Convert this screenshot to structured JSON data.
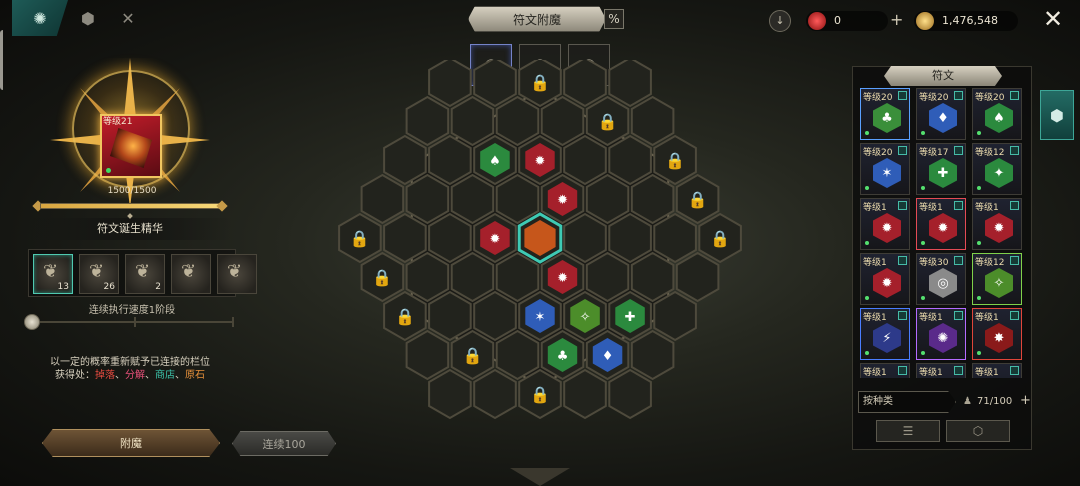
{
  "left_tabs": [
    {
      "icon": "gear-emblem-icon",
      "active": true
    },
    {
      "icon": "hexagon-icon",
      "active": false
    },
    {
      "icon": "crossed-tools-icon",
      "active": false
    }
  ],
  "essence": {
    "level_label": "等级21",
    "count_text": "1500/1500",
    "fill_fraction": 1.0,
    "name": "符文诞生精华"
  },
  "materials": [
    {
      "icon": "rune-fragment-icon",
      "qty": "13",
      "selected": true
    },
    {
      "icon": "rune-fragment-icon",
      "qty": "26",
      "selected": false
    },
    {
      "icon": "rune-fragment-icon",
      "qty": "2",
      "selected": false
    },
    {
      "icon": "rune-fragment-icon",
      "qty": "",
      "selected": false
    },
    {
      "icon": "rune-fragment-icon",
      "qty": "",
      "selected": false
    }
  ],
  "speed": {
    "label": "连续执行速度1阶段",
    "level_fraction": 0
  },
  "description": {
    "line1": "以一定的概率重新赋予已连接的栏位",
    "source_prefix": "获得处：",
    "sources": [
      "掉落",
      "分解",
      "商店",
      "原石"
    ],
    "separator": "、"
  },
  "buttons": {
    "enchant": "附魔",
    "continuous": "连续100"
  },
  "center": {
    "title": "符文附魔",
    "percent_symbol": "%",
    "rune_tabs": [
      {
        "icon": "spiral-rune-icon",
        "active": true
      },
      {
        "icon": "spiral-rune-icon",
        "active": false
      },
      {
        "icon": "spiral-rune-icon",
        "active": false
      }
    ]
  },
  "currency": {
    "download_icon": "download-arrow-icon",
    "red_gem": {
      "icon": "red-gem-icon",
      "value": "0"
    },
    "gold": {
      "icon": "gold-coin-icon",
      "value": "1,476,548"
    },
    "plus_symbol": "+",
    "close_symbol": "✕"
  },
  "rune_panel": {
    "title": "符文",
    "side_tab_icon": "hexagon-emblem-icon",
    "cards": [
      {
        "level": "等级20",
        "color": "#3a8f3a",
        "border": "#5aa0ff",
        "glyph": "♣"
      },
      {
        "level": "等级20",
        "color": "#2f5db8",
        "border": "#3e3c36",
        "glyph": "♦"
      },
      {
        "level": "等级20",
        "color": "#2b8a3e",
        "border": "#3e3c36",
        "glyph": "♠"
      },
      {
        "level": "等级20",
        "color": "#2f5db8",
        "border": "#3e3c36",
        "glyph": "✶"
      },
      {
        "level": "等级17",
        "color": "#2b8a3e",
        "border": "#3e3c36",
        "glyph": "✚"
      },
      {
        "level": "等级12",
        "color": "#2b8a3e",
        "border": "#3e3c36",
        "glyph": "✦"
      },
      {
        "level": "等级1",
        "color": "#a5202b",
        "border": "#3e3c36",
        "glyph": "✹"
      },
      {
        "level": "等级1",
        "color": "#a5202b",
        "border": "#e44b55",
        "glyph": "✹"
      },
      {
        "level": "等级1",
        "color": "#a5202b",
        "border": "#3e3c36",
        "glyph": "✹"
      },
      {
        "level": "等级1",
        "color": "#a5202b",
        "border": "#3e3c36",
        "glyph": "✹"
      },
      {
        "level": "等级30",
        "color": "#8a8a8a",
        "border": "#3e3c36",
        "glyph": "◎"
      },
      {
        "level": "等级12",
        "color": "#4c8d2a",
        "border": "#7fd14a",
        "glyph": "✧"
      },
      {
        "level": "等级1",
        "color": "#2d3a8a",
        "border": "#4a7dff",
        "glyph": "⚡"
      },
      {
        "level": "等级1",
        "color": "#5a2a8a",
        "border": "#b46bff",
        "glyph": "✺"
      },
      {
        "level": "等级1",
        "color": "#8a1a1a",
        "border": "#e0453a",
        "glyph": "✸"
      },
      {
        "level": "等级1",
        "color": "#2b7a3a",
        "border": "#3e3c36",
        "glyph": "✶"
      },
      {
        "level": "等级1",
        "color": "#2b7a3a",
        "border": "#3e3c36",
        "glyph": "✶"
      },
      {
        "level": "等级1",
        "color": "#2b7a3a",
        "border": "#3e3c36",
        "glyph": "✶"
      }
    ],
    "sort_label": "按种类",
    "capacity": "71/100",
    "capacity_icon": "bag-icon",
    "capacity_plus": "+",
    "bottom_buttons": [
      {
        "icon": "list-check-icon",
        "glyph": "☰"
      },
      {
        "icon": "cube-icon",
        "glyph": "⬡"
      }
    ]
  },
  "board": {
    "center_rune": {
      "type": "core",
      "color": "#c6561b"
    },
    "placed": [
      {
        "q": 0,
        "r": -2,
        "color": "#2b8a3e",
        "glyph": "♠"
      },
      {
        "q": 1,
        "r": -2,
        "color": "#a5202b",
        "glyph": "✹"
      },
      {
        "q": -1,
        "r": 0,
        "color": "#a5202b",
        "glyph": "✹"
      },
      {
        "q": 1,
        "r": -1,
        "color": "#a5202b",
        "glyph": "✹"
      },
      {
        "q": 0,
        "r": 1,
        "color": "#a5202b",
        "glyph": "✹"
      },
      {
        "q": -1,
        "r": 2,
        "color": "#2f5db8",
        "glyph": "✶"
      },
      {
        "q": 0,
        "r": 2,
        "color": "#4c8d2a",
        "glyph": "✧"
      },
      {
        "q": 1,
        "r": 2,
        "color": "#2b8a3e",
        "glyph": "✚"
      },
      {
        "q": -1,
        "r": 3,
        "color": "#2b8a3e",
        "glyph": "♣"
      },
      {
        "q": 0,
        "r": 3,
        "color": "#2f5db8",
        "glyph": "♦"
      }
    ],
    "locked": [
      {
        "q": -2,
        "r": -3
      },
      {
        "q": 2,
        "r": -4
      },
      {
        "q": -3,
        "r": -2
      },
      {
        "q": 3,
        "r": -3
      },
      {
        "q": -4,
        "r": -1
      },
      {
        "q": 4,
        "r": -2
      },
      {
        "q": -4,
        "r": 0
      },
      {
        "q": 4,
        "r": -1
      },
      {
        "q": -4,
        "r": 1
      },
      {
        "q": 4,
        "r": 0
      },
      {
        "q": -4,
        "r": 2
      },
      {
        "q": 4,
        "r": 1
      },
      {
        "q": -3,
        "r": 3
      },
      {
        "q": 3,
        "r": 2
      },
      {
        "q": -2,
        "r": 4
      },
      {
        "q": 2,
        "r": 3
      }
    ]
  }
}
